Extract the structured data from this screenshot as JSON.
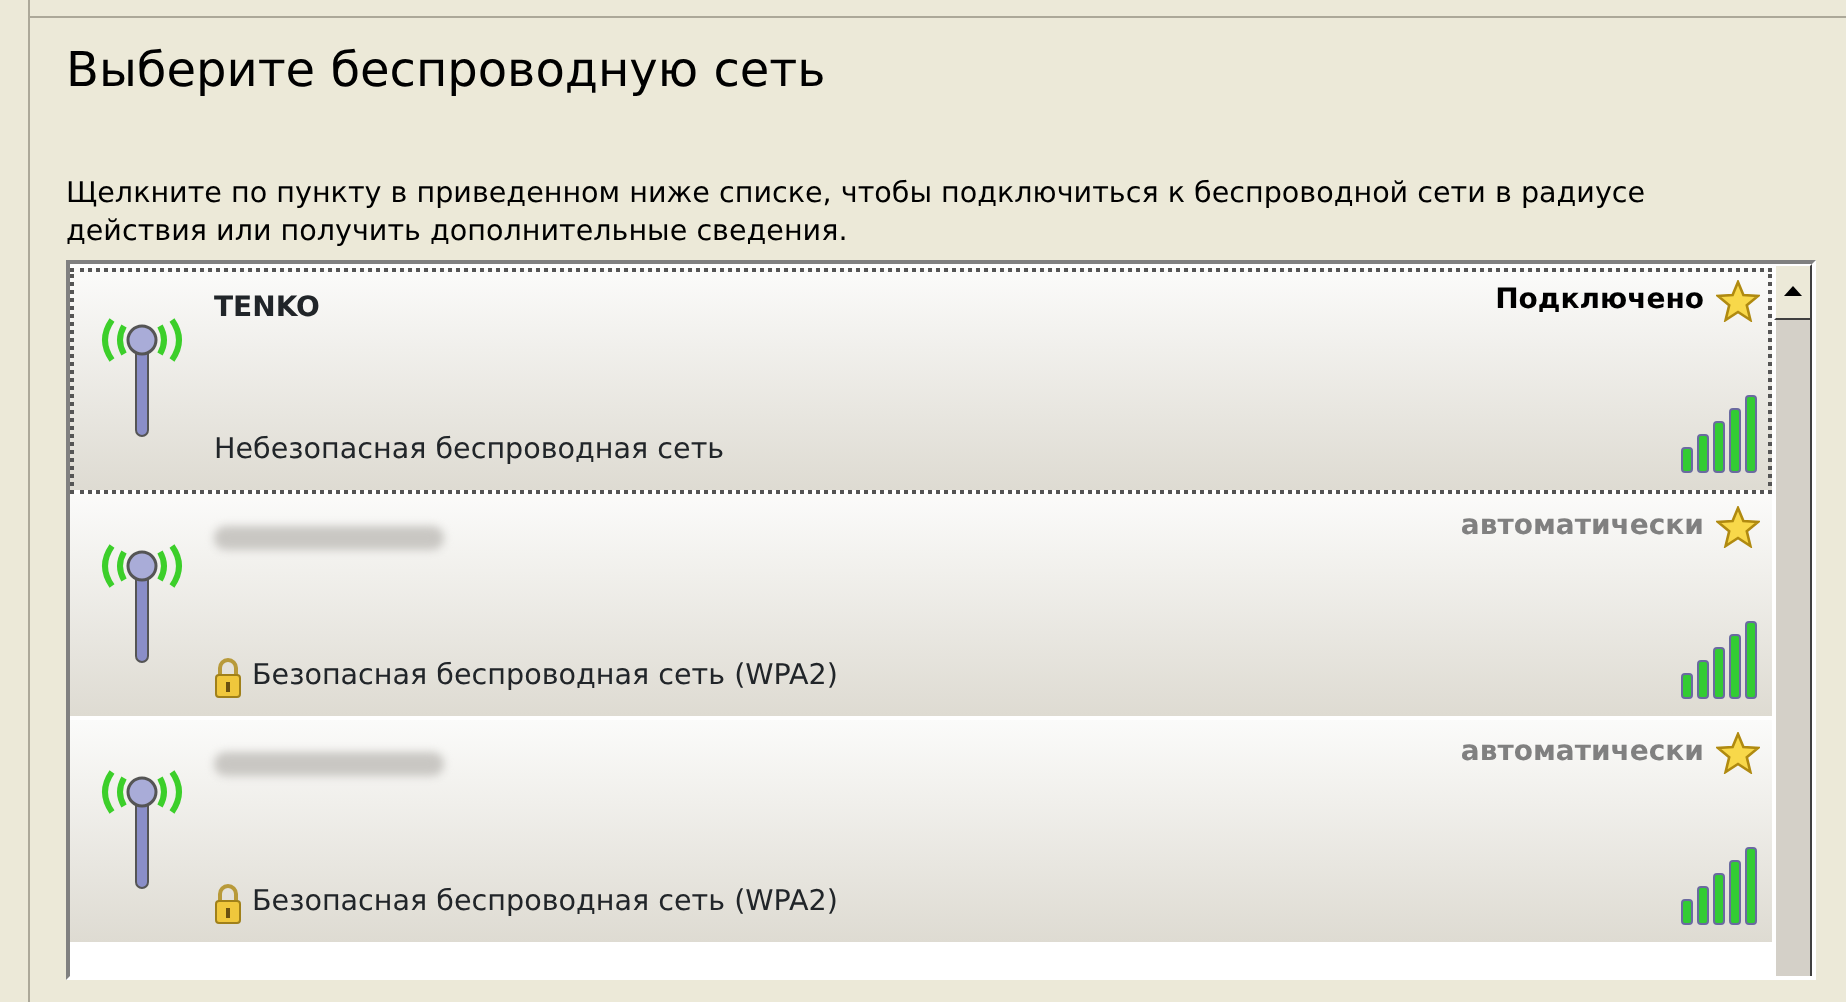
{
  "heading": "Выберите беспроводную сеть",
  "description": "Щелкните по пункту в приведенном ниже списке, чтобы подключиться к беспроводной сети в радиусе действия или получить дополнительные сведения.",
  "networks": [
    {
      "kind": "named",
      "name": "TENKO",
      "status": "Подключено",
      "connected": true,
      "selected": true,
      "secure": false,
      "security": "Небезопасная беспроводная сеть",
      "level": 1
    },
    {
      "kind": "hidden",
      "status": "автоматически",
      "connected": false,
      "selected": false,
      "secure": true,
      "security": "Безопасная беспроводная сеть (WPA2)",
      "level": 1
    },
    {
      "kind": "hidden",
      "status": "автоматически",
      "connected": false,
      "selected": false,
      "secure": true,
      "security": "Безопасная беспроводная сеть (WPA2)",
      "level": 1
    }
  ]
}
